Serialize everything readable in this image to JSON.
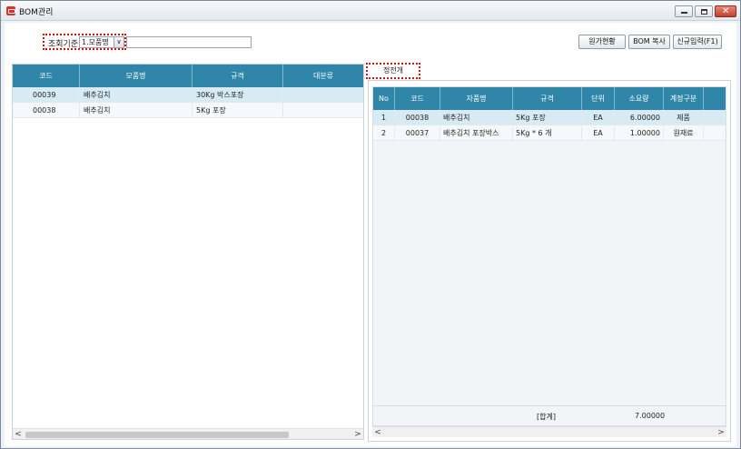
{
  "window": {
    "title": "BOM관리"
  },
  "toolbar": {
    "search_label": "조회기준",
    "search_combo": "1.모품명",
    "search_value": "",
    "buttons": [
      "원가현황",
      "BOM 복사",
      "신규입력(F1)"
    ]
  },
  "left_grid": {
    "columns": [
      "코드",
      "모품명",
      "규격",
      "대분류"
    ],
    "rows": [
      [
        "00039",
        "배추김치",
        "30Kg 박스포장",
        ""
      ],
      [
        "00038",
        "배추김치",
        "5Kg 포장",
        ""
      ]
    ]
  },
  "right_tab": "정전개",
  "right_grid": {
    "columns": [
      "No",
      "코드",
      "자품명",
      "규격",
      "단위",
      "소요량",
      "계정구분"
    ],
    "rows": [
      [
        "1",
        "00038",
        "배추김치",
        "5Kg 포장",
        "EA",
        "6.00000",
        "제품"
      ],
      [
        "2",
        "00037",
        "배추김치 포장박스",
        "5Kg * 6 개",
        "EA",
        "1.00000",
        "원재료"
      ]
    ],
    "footer_label": "[합계]",
    "footer_total": "7.00000"
  },
  "scroll": {
    "left": "<",
    "right": ">"
  }
}
